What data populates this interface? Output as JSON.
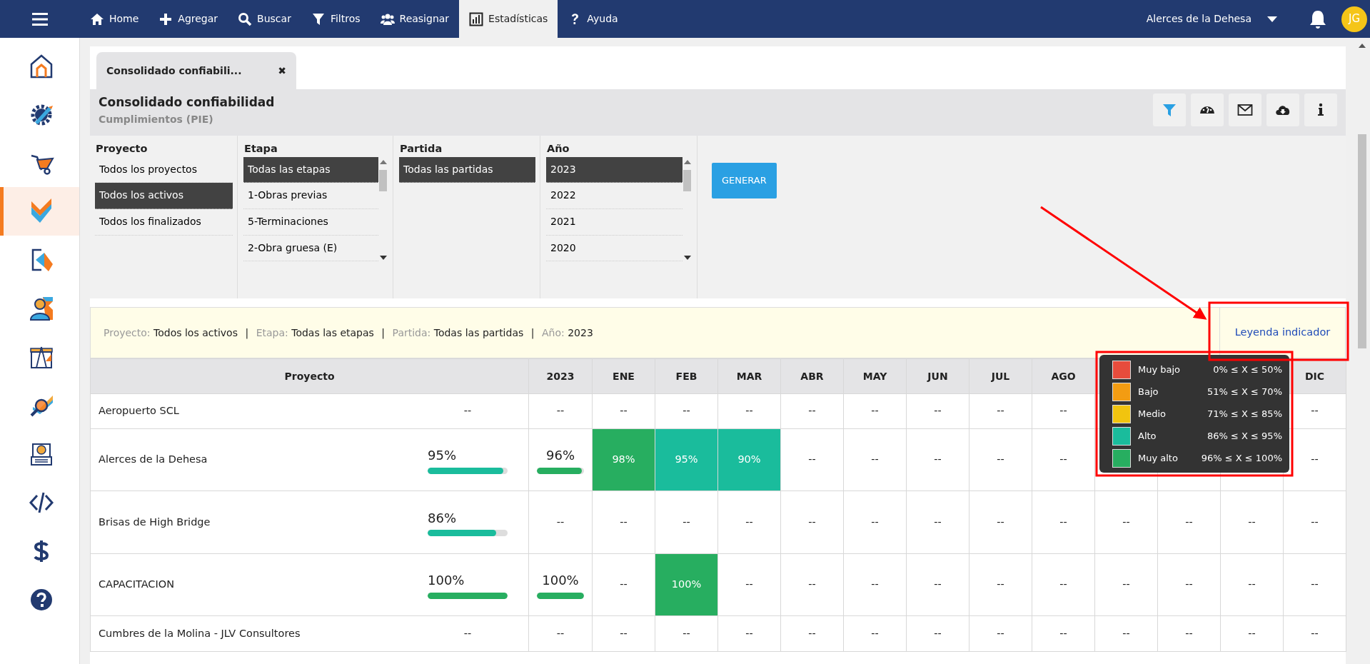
{
  "topbar": {
    "nav": [
      {
        "label": "Home",
        "selected": false
      },
      {
        "label": "Agregar",
        "selected": false
      },
      {
        "label": "Buscar",
        "selected": false
      },
      {
        "label": "Filtros",
        "selected": false
      },
      {
        "label": "Reasignar",
        "selected": false
      },
      {
        "label": "Estadísticas",
        "selected": true
      },
      {
        "label": "Ayuda",
        "selected": false
      }
    ],
    "project_selector": "Alerces de la Dehesa",
    "avatar": "JG"
  },
  "sidebar": {
    "items": [
      {
        "selected": false
      },
      {
        "selected": false
      },
      {
        "selected": false
      },
      {
        "selected": true
      },
      {
        "selected": false
      },
      {
        "selected": false
      },
      {
        "selected": false
      },
      {
        "selected": false
      },
      {
        "selected": false
      },
      {
        "selected": false
      },
      {
        "selected": false
      },
      {
        "selected": false
      }
    ]
  },
  "tab": {
    "label": "Consolidado confiabili...",
    "close": "✖"
  },
  "report": {
    "title": "Consolidado confiabilidad",
    "subtitle": "Cumplimientos (PIE)"
  },
  "filters": [
    {
      "title": "Proyecto",
      "scrollable": false,
      "options": [
        {
          "label": "Todos los proyectos",
          "selected": false
        },
        {
          "label": "Todos los activos",
          "selected": true
        },
        {
          "label": "Todos los finalizados",
          "selected": false
        }
      ]
    },
    {
      "title": "Etapa",
      "scrollable": true,
      "options": [
        {
          "label": "Todas las etapas",
          "selected": true
        },
        {
          "label": "1-Obras previas",
          "selected": false
        },
        {
          "label": "5-Terminaciones",
          "selected": false
        },
        {
          "label": "2-Obra gruesa (E)",
          "selected": false
        }
      ]
    },
    {
      "title": "Partida",
      "scrollable": false,
      "options": [
        {
          "label": "Todas las partidas",
          "selected": true
        }
      ]
    },
    {
      "title": "Año",
      "scrollable": true,
      "options": [
        {
          "label": "2023",
          "selected": true
        },
        {
          "label": "2022",
          "selected": false
        },
        {
          "label": "2021",
          "selected": false
        },
        {
          "label": "2020",
          "selected": false
        }
      ]
    }
  ],
  "generate_button": "GENERAR",
  "summary": {
    "segments": [
      {
        "kind": "field",
        "label": "Proyecto:",
        "value": "Todos los activos"
      },
      {
        "kind": "separator",
        "text": "|"
      },
      {
        "kind": "field",
        "label": "Etapa:",
        "value": "Todas las etapas"
      },
      {
        "kind": "separator",
        "text": "|"
      },
      {
        "kind": "field",
        "label": "Partida:",
        "value": "Todas las partidas"
      },
      {
        "kind": "separator",
        "text": "|"
      },
      {
        "kind": "field",
        "label": "Año:",
        "value": "2023"
      }
    ],
    "legend_link": "Leyenda indicador"
  },
  "table": {
    "columns": [
      {
        "label": "Proyecto"
      },
      {
        "label": "2023"
      },
      {
        "label": "ENE"
      },
      {
        "label": "FEB"
      },
      {
        "label": "MAR"
      },
      {
        "label": "ABR"
      },
      {
        "label": "MAY"
      },
      {
        "label": "JUN"
      },
      {
        "label": "JUL"
      },
      {
        "label": "AGO"
      },
      null,
      null,
      null,
      {
        "label": "DIC"
      }
    ],
    "rows": [
      {
        "cells": [
          {
            "name": "Aeropuerto SCL",
            "total": {
              "text": "--"
            }
          },
          {
            "text": "--"
          },
          {
            "text": "--"
          },
          {
            "text": "--"
          },
          {
            "text": "--"
          },
          {
            "text": "--"
          },
          {
            "text": "--"
          },
          {
            "text": "--"
          },
          {
            "text": "--"
          },
          {
            "text": "--"
          },
          null,
          null,
          null,
          {
            "text": "--"
          }
        ]
      },
      {
        "cells": [
          {
            "name": "Alerces de la Dehesa",
            "total": {
              "text": "95%",
              "level": 0.95,
              "color": "#1abc9c"
            }
          },
          {
            "text": "96%",
            "level": 0.96,
            "color": "#27ae60",
            "kind": "bar"
          },
          {
            "text": "98%",
            "color": "#27ae60"
          },
          {
            "text": "95%",
            "color": "#1abc9c"
          },
          {
            "text": "90%",
            "color": "#1abc9c"
          },
          {
            "text": "--"
          },
          {
            "text": "--"
          },
          {
            "text": "--"
          },
          {
            "text": "--"
          },
          {
            "text": "--"
          },
          null,
          null,
          null,
          {
            "text": "--"
          }
        ]
      },
      {
        "cells": [
          {
            "name": "Brisas de High Bridge",
            "total": {
              "text": "86%",
              "level": 0.86,
              "color": "#1abc9c"
            }
          },
          {
            "text": "--"
          },
          {
            "text": "--"
          },
          {
            "text": "--"
          },
          {
            "text": "--"
          },
          {
            "text": "--"
          },
          {
            "text": "--"
          },
          {
            "text": "--"
          },
          {
            "text": "--"
          },
          {
            "text": "--"
          },
          {
            "text": "--"
          },
          {
            "text": "--"
          },
          {
            "text": "--"
          },
          {
            "text": "--"
          }
        ]
      },
      {
        "cells": [
          {
            "name": "CAPACITACION",
            "total": {
              "text": "100%",
              "level": 1,
              "color": "#27ae60"
            }
          },
          {
            "text": "100%",
            "level": 1,
            "color": "#27ae60",
            "kind": "bar"
          },
          {
            "text": "--"
          },
          {
            "text": "100%",
            "color": "#27ae60"
          },
          {
            "text": "--"
          },
          {
            "text": "--"
          },
          {
            "text": "--"
          },
          {
            "text": "--"
          },
          {
            "text": "--"
          },
          {
            "text": "--"
          },
          {
            "text": "--"
          },
          {
            "text": "--"
          },
          {
            "text": "--"
          },
          {
            "text": "--"
          }
        ]
      },
      {
        "cells": [
          {
            "name": "Cumbres de la Molina - JLV Consultores",
            "total": {
              "text": "--"
            }
          },
          {
            "text": "--"
          },
          {
            "text": "--"
          },
          {
            "text": "--"
          },
          {
            "text": "--"
          },
          {
            "text": "--"
          },
          {
            "text": "--"
          },
          {
            "text": "--"
          },
          {
            "text": "--"
          },
          {
            "text": "--"
          },
          {
            "text": "--"
          },
          {
            "text": "--"
          },
          {
            "text": "--"
          },
          {
            "text": "--"
          }
        ]
      }
    ]
  },
  "legend": {
    "items": [
      {
        "label": "Muy bajo",
        "range": "0% ≤ X ≤ 50%",
        "color": "#e74c3c"
      },
      {
        "label": "Bajo",
        "range": "51% ≤ X ≤ 70%",
        "color": "#f39c12"
      },
      {
        "label": "Medio",
        "range": "71% ≤ X ≤ 85%",
        "color": "#f1c40f"
      },
      {
        "label": "Alto",
        "range": "86% ≤ X ≤ 95%",
        "color": "#1abc9c"
      },
      {
        "label": "Muy alto",
        "range": "96% ≤ X ≤ 100%",
        "color": "#27ae60"
      }
    ]
  }
}
